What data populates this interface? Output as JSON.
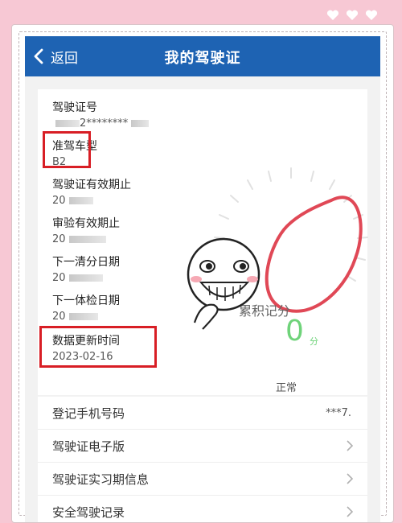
{
  "header": {
    "back_label": "返回",
    "title": "我的驾驶证"
  },
  "license": {
    "number_label": "驾驶证号",
    "number_value": "2********",
    "class_label": "准驾车型",
    "class_value": "B2",
    "valid_until_label": "驾驶证有效期止",
    "valid_until_value": "20",
    "review_until_label": "审验有效期止",
    "review_until_value": "20",
    "clear_date_label": "下一清分日期",
    "clear_date_value": "20",
    "physical_date_label": "下一体检日期",
    "physical_date_value": "20",
    "updated_label": "数据更新时间",
    "updated_value": "2023-02-16"
  },
  "score": {
    "label": "累积记分",
    "value": "0",
    "unit": "分",
    "status": "正常"
  },
  "list": [
    {
      "label": "登记手机号码",
      "value": "***7."
    },
    {
      "label": "驾驶证电子版"
    },
    {
      "label": "驾驶证实习期信息"
    },
    {
      "label": "安全驾驶记录"
    }
  ],
  "colors": {
    "header_bg": "#1e63b3",
    "highlight": "#d81e25",
    "score_green": "#6fd37a",
    "backdrop": "#f7c8d4"
  },
  "icons": [
    "back-arrow-icon",
    "chevron-right-icon",
    "heart-icon"
  ]
}
